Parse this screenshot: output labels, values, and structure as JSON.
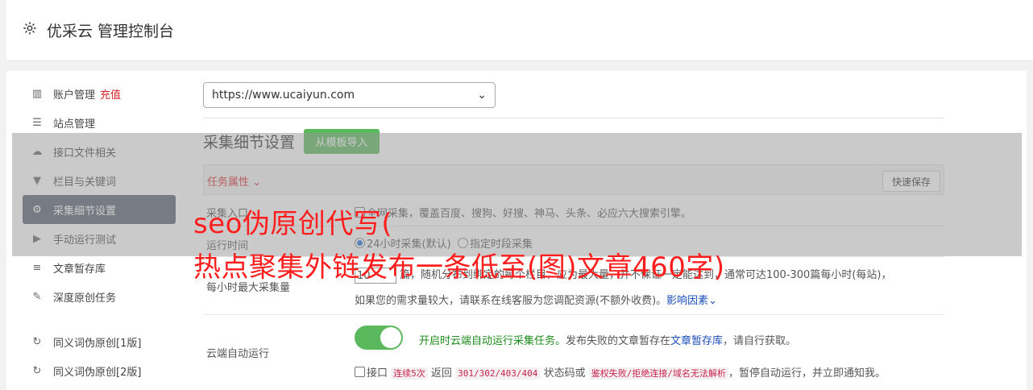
{
  "header": {
    "title": "优采云 管理控制台"
  },
  "sidebar": {
    "items": [
      {
        "label": "账户管理",
        "badge": "充值"
      },
      {
        "label": "站点管理"
      },
      {
        "label": "接口文件相关"
      },
      {
        "label": "栏目与关键词"
      },
      {
        "label": "采集细节设置"
      },
      {
        "label": "手动运行测试"
      },
      {
        "label": "文章暂存库"
      },
      {
        "label": "深度原创任务"
      },
      {
        "label": "同义词伪原创[1版]"
      },
      {
        "label": "同义词伪原创[2版]"
      }
    ]
  },
  "main": {
    "site_select": "https://www.ucaiyun.com",
    "section_title": "采集细节设置",
    "template_btn": "从模板导入",
    "task_attr": "任务属性",
    "quick_save": "快速保存",
    "entry_label": "采集入口",
    "entry_check": "全网采集",
    "entry_desc": "覆盖百度、搜狗、好搜、神马、头条、必应六大搜索引擎。",
    "runtime_label": "运行时间",
    "runtime_opt1": "24小时采集(默认)",
    "runtime_opt2": "指定时段采集",
    "max_label": "每小时最大采集量",
    "max_value": "10",
    "max_desc1": "篇，随机分布到绑定的每个栏目，应为最大量，并不保证一定能达到，通常可达100-300篇每小时(每站)，",
    "max_desc2": "如果您的需求量较大，请联系在线客服为您调配资源(不额外收费)。",
    "max_link": "影响因素",
    "cloud_label": "云端自动运行",
    "cloud_on": "开启时云端自动运行采集任务。",
    "cloud_desc1": "发布失败的文章暂存在",
    "cloud_link": "文章暂存库",
    "cloud_desc2": "，请自行获取。",
    "api_pre": "接口",
    "api_code1": "连续5次",
    "api_mid1": "返回",
    "api_code2": "301/302/403/404",
    "api_mid2": "状态码或",
    "api_code3": "鉴权失败/拒绝连接/域名无法解析",
    "api_post": "，暂停自动运行，并立即通知我。"
  },
  "overlay": {
    "line1": "seo伪原创代写(",
    "line2": "热点聚集外链发布一条低至(图)文章460字)"
  },
  "colors": {
    "accent": "#5cb85c",
    "active_nav": "#586170",
    "red": "#d9252b",
    "link": "#1a4cb8"
  }
}
